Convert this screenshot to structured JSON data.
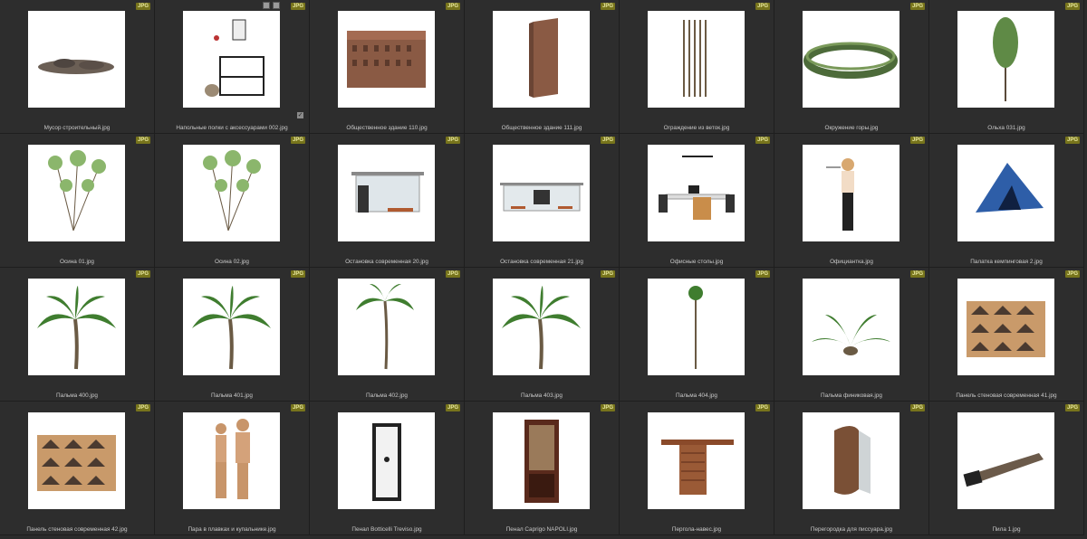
{
  "badge_text": "JPG",
  "items": [
    {
      "label": "Мусор строительный.jpg",
      "icon": "rubble-icon"
    },
    {
      "label": "Напольные полки с аксессуарами 002.jpg",
      "icon": "shelf-icon",
      "selected": true
    },
    {
      "label": "Общественное здание 110.jpg",
      "icon": "building-icon"
    },
    {
      "label": "Общественное здание 111.jpg",
      "icon": "tower-icon"
    },
    {
      "label": "Ограждение из веток.jpg",
      "icon": "fence-icon"
    },
    {
      "label": "Окружение горы.jpg",
      "icon": "mountains-icon"
    },
    {
      "label": "Ольха 031.jpg",
      "icon": "tree-icon"
    },
    {
      "label": "Осина 01.jpg",
      "icon": "shrub-icon"
    },
    {
      "label": "Осина 02.jpg",
      "icon": "shrub-icon"
    },
    {
      "label": "Остановка современная 20.jpg",
      "icon": "bus-stop-icon"
    },
    {
      "label": "Остановка современная 21.jpg",
      "icon": "bus-stop-wide-icon"
    },
    {
      "label": "Офисные столы.jpg",
      "icon": "office-desk-icon"
    },
    {
      "label": "Официантка.jpg",
      "icon": "waitress-icon"
    },
    {
      "label": "Палатка кемпинговая 2.jpg",
      "icon": "tent-icon"
    },
    {
      "label": "Пальма 400.jpg",
      "icon": "palm-icon"
    },
    {
      "label": "Пальма 401.jpg",
      "icon": "palm-icon"
    },
    {
      "label": "Пальма 402.jpg",
      "icon": "palm-tall-icon"
    },
    {
      "label": "Пальма 403.jpg",
      "icon": "palm-icon"
    },
    {
      "label": "Пальма 404.jpg",
      "icon": "palm-slim-icon"
    },
    {
      "label": "Пальма финиковая.jpg",
      "icon": "palm-low-icon"
    },
    {
      "label": "Панель стеновая современная 41.jpg",
      "icon": "wall-panel-icon"
    },
    {
      "label": "Панель стеновая современная 42.jpg",
      "icon": "wall-panel-icon"
    },
    {
      "label": "Пара в плавках и купальнике.jpg",
      "icon": "couple-icon"
    },
    {
      "label": "Пенал Botticelli Treviso.jpg",
      "icon": "cabinet-icon"
    },
    {
      "label": "Пенал Caprigo NAPOLI.jpg",
      "icon": "showcase-icon"
    },
    {
      "label": "Пергола-навес.jpg",
      "icon": "pergola-icon"
    },
    {
      "label": "Перегородка для писсуара.jpg",
      "icon": "partition-icon"
    },
    {
      "label": "Пила 1.jpg",
      "icon": "saw-icon"
    }
  ]
}
